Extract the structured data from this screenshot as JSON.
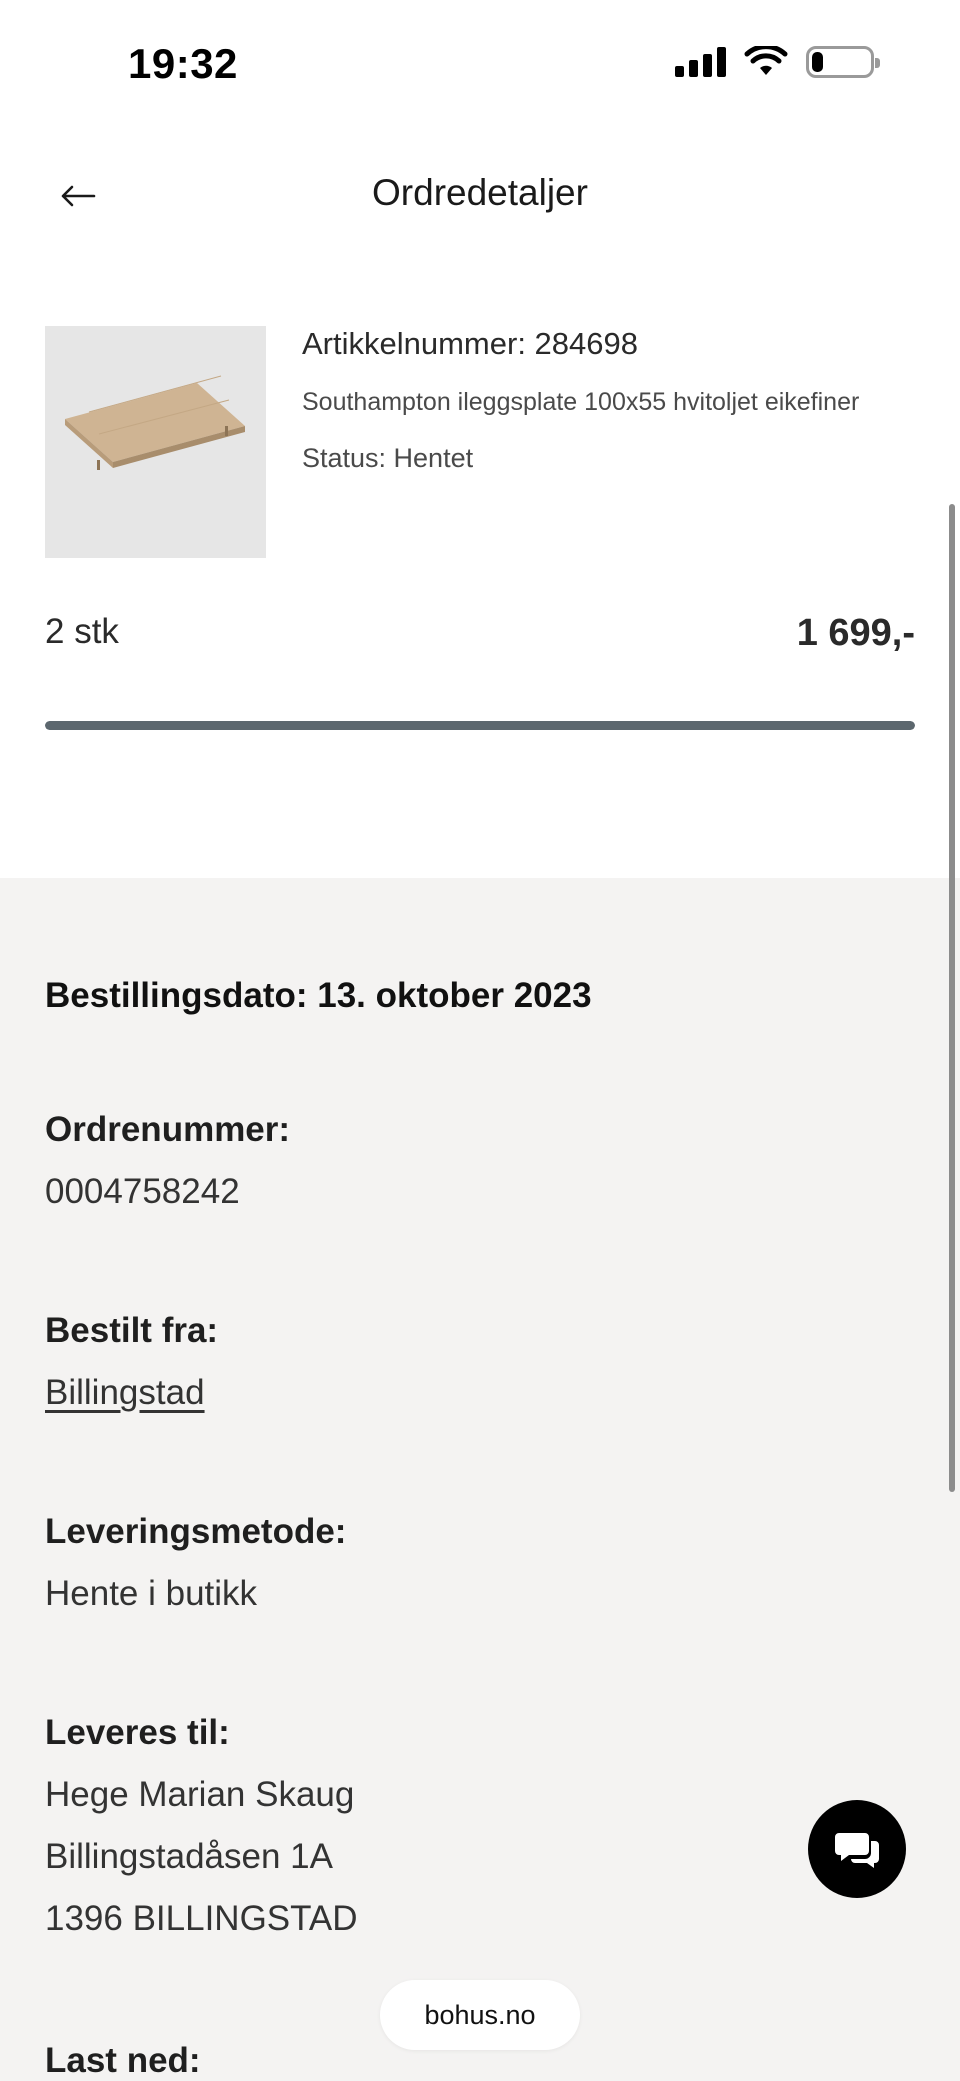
{
  "status_bar": {
    "time": "19:32",
    "battery_level": 0.2
  },
  "header": {
    "title": "Ordredetaljer",
    "back_icon": "arrow-left-icon"
  },
  "product": {
    "article_number": "Artikkelnummer: 284698",
    "name": "Southampton ileggsplate 100x55 hvitoljet eikefiner",
    "status": "Status: Hentet",
    "quantity": "2 stk",
    "price": "1 699,-",
    "progress": 1.0
  },
  "details": {
    "order_date": "Bestillingsdato: 13. oktober 2023",
    "order_number_label": "Ordrenummer:",
    "order_number": "0004758242",
    "ordered_from_label": "Bestilt fra:",
    "ordered_from": "Billingstad",
    "delivery_method_label": "Leveringsmetode:",
    "delivery_method": "Hente i butikk",
    "deliver_to_label": "Leveres til:",
    "deliver_to_name": "Hege Marian Skaug",
    "deliver_to_street": "Billingstadåsen 1A",
    "deliver_to_city": "1396 BILLINGSTAD",
    "download_label": "Last ned:"
  },
  "site_label": "bohus.no",
  "colors": {
    "progress": "#5c676e",
    "details_bg": "#f4f3f2",
    "chat_button": "#000000"
  }
}
